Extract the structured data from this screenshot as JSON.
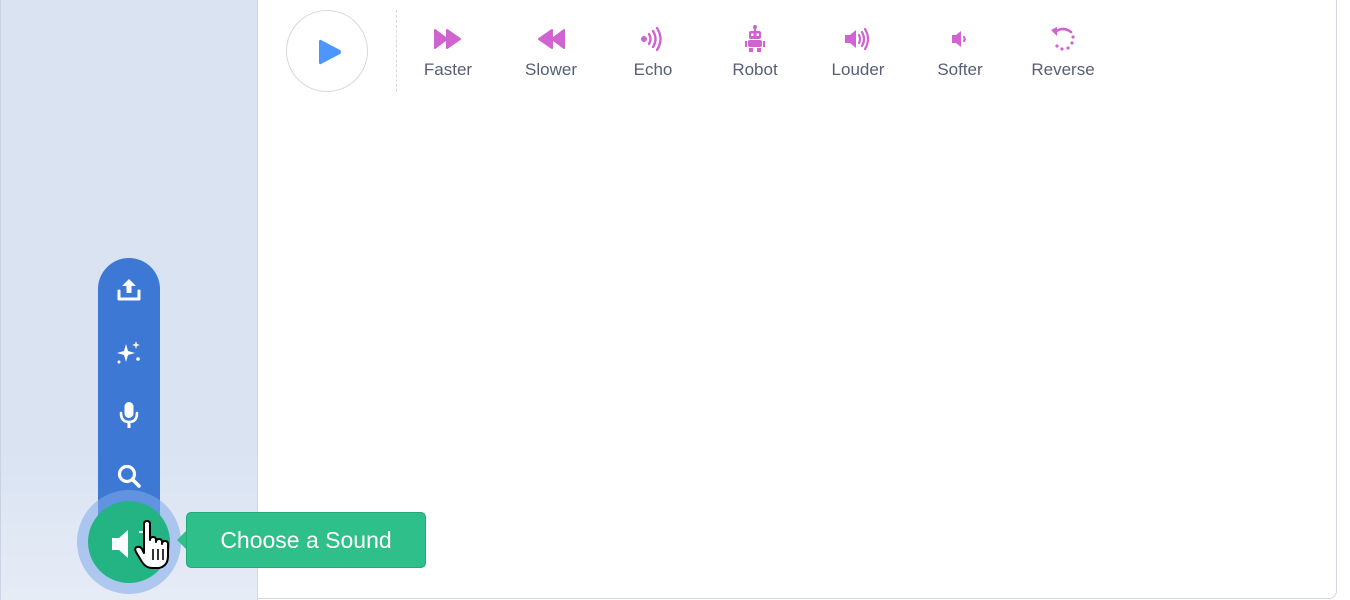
{
  "toolbar": {
    "play_icon": "play-icon",
    "effects": [
      {
        "label": "Faster",
        "icon": "fast-forward-icon"
      },
      {
        "label": "Slower",
        "icon": "rewind-icon"
      },
      {
        "label": "Echo",
        "icon": "echo-icon"
      },
      {
        "label": "Robot",
        "icon": "robot-icon"
      },
      {
        "label": "Louder",
        "icon": "louder-icon"
      },
      {
        "label": "Softer",
        "icon": "softer-icon"
      },
      {
        "label": "Reverse",
        "icon": "reverse-icon"
      }
    ]
  },
  "sound_menu": {
    "items": [
      {
        "icon": "upload-icon"
      },
      {
        "icon": "surprise-sparkle-icon"
      },
      {
        "icon": "microphone-icon"
      },
      {
        "icon": "search-icon"
      }
    ],
    "choose_button_icon": "speaker-plus-icon",
    "tooltip": "Choose a Sound"
  },
  "colors": {
    "effect": "#cf63cf",
    "play": "#4c97ff",
    "menu": "#3d78d4",
    "choose": "#24b382",
    "tooltip": "#2fbf8a",
    "label": "#575e75"
  }
}
